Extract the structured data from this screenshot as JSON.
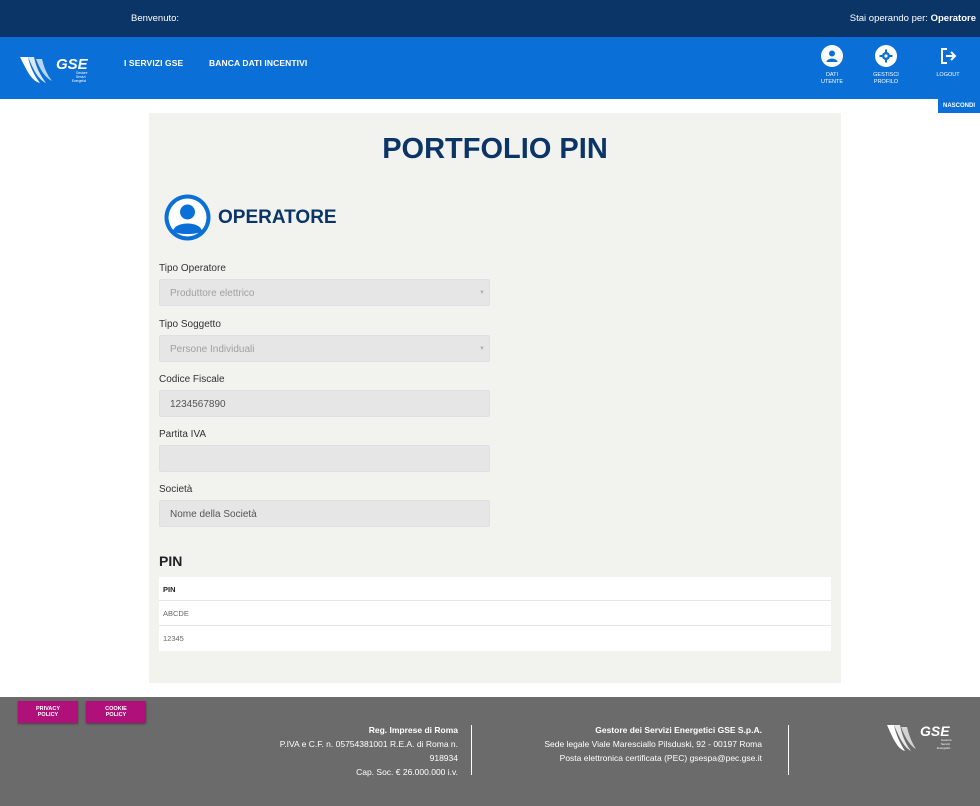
{
  "topbar": {
    "welcome": "Benvenuto:",
    "operating_prefix": "Stai operando per: ",
    "operating_role": "Operatore"
  },
  "nav": {
    "logo_text": "GSE",
    "logo_sub": [
      "Gestore",
      "Servizi",
      "Energetici"
    ],
    "links": [
      "I SERVIZI GSE",
      "BANCA DATI INCENTIVI"
    ],
    "actions": [
      {
        "label_1": "DATI",
        "label_2": "UTENTE",
        "icon": "user-icon"
      },
      {
        "label_1": "GESTISCI",
        "label_2": "PROFILO",
        "icon": "gear-icon"
      },
      {
        "label_1": "LOGOUT",
        "label_2": "",
        "icon": "logout-icon"
      }
    ],
    "hide_label": "NASCONDI"
  },
  "main": {
    "title": "PORTFOLIO PIN",
    "section_title": "OPERATORE",
    "fields": [
      {
        "label": "Tipo Operatore",
        "value": "Produttore elettrico",
        "type": "select"
      },
      {
        "label": "Tipo Soggetto",
        "value": "Persone Individuali",
        "type": "select"
      },
      {
        "label": "Codice Fiscale",
        "value": "1234567890",
        "type": "text"
      },
      {
        "label": "Partita IVA",
        "value": "",
        "type": "text"
      },
      {
        "label": "Società",
        "value": "Nome della Società",
        "type": "text"
      }
    ],
    "pin_heading": "PIN",
    "pin_table": {
      "header": "PIN",
      "rows": [
        "ABCDE",
        "12345"
      ]
    }
  },
  "footer": {
    "privacy": [
      "PRIVACY",
      "POLICY"
    ],
    "cookie": [
      "COOKIE",
      "POLICY"
    ],
    "col1": [
      "Reg. Imprese di Roma",
      "P.IVA e C.F. n. 05754381001 R.E.A. di Roma n.",
      "918934",
      "Cap. Soc. € 26.000.000 i.v."
    ],
    "col2": [
      "Gestore dei Servizi Energetici GSE S.p.A.",
      "Sede legale Viale Maresciallo Pilsduski, 92 - 00197 Roma",
      "Posta elettronica certificata (PEC) gsespa@pec.gse.it"
    ]
  },
  "colors": {
    "topbar": "#0a3566",
    "nav": "#0a6fd6",
    "title": "#0a3566",
    "policy": "#b0107a",
    "footer": "#6b6b6b"
  }
}
